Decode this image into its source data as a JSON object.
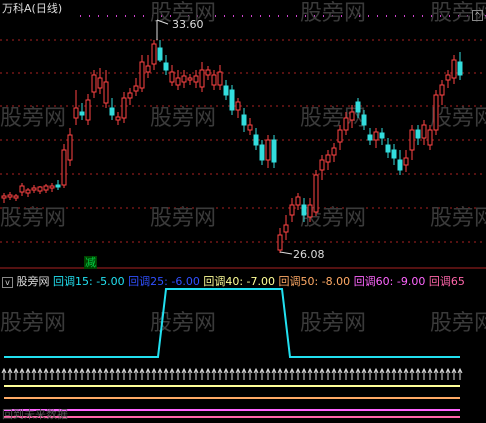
{
  "upper_panel": {
    "title": "万科A(日线)",
    "corner_icon": "chevron-up-icon",
    "high_label": "33.60",
    "low_label": "26.08",
    "signal_label": "减",
    "signal_color": "#00cc44"
  },
  "lower_panel": {
    "indicator_name": "股旁网",
    "items": [
      {
        "label": "回调15: -5.00",
        "color": "#22e0f0"
      },
      {
        "label": "回调25: -6.00",
        "color": "#3050ff"
      },
      {
        "label": "回调40: -7.00",
        "color": "#ffff99"
      },
      {
        "label": "回调50: -8.00",
        "color": "#ffaa66"
      },
      {
        "label": "回调60: -9.00",
        "color": "#ff66ff"
      },
      {
        "label": "回调65",
        "color": "#ff66aa"
      }
    ],
    "footer_text": "回到未来数据"
  },
  "watermark": "股旁网",
  "colors": {
    "up": "#ff4444",
    "down": "#33dddd",
    "grid": "#aa2222",
    "arrow": "#dddddd"
  }
}
